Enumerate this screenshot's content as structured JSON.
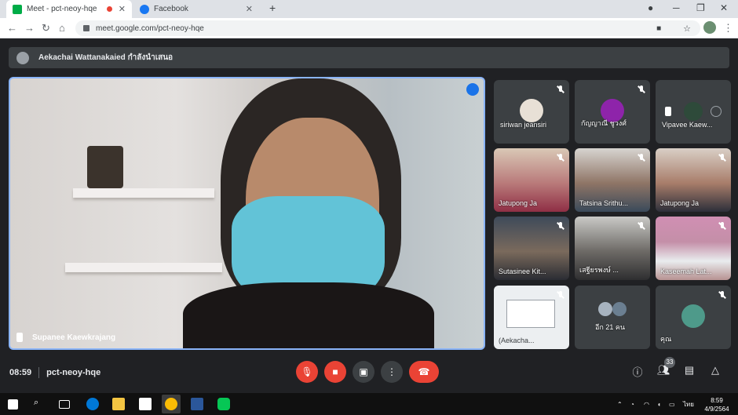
{
  "browser": {
    "tabs": [
      {
        "title": "Meet - pct-neoy-hqe",
        "active": true
      },
      {
        "title": "Facebook",
        "active": false
      }
    ],
    "address": "meet.google.com/pct-neoy-hqe"
  },
  "presenter_bar": {
    "text": "Aekachai Wattanakaied กำลังนำเสนอ"
  },
  "main_tile": {
    "name": "Supanee Kaewkrajang"
  },
  "tiles": [
    {
      "name": "siriwan jeansiri"
    },
    {
      "name": "กัญญาณี ชูวงศ์"
    },
    {
      "name": "Vipavee Kaew..."
    },
    {
      "name": "Jatupong Ja"
    },
    {
      "name": "Tatsina Srithu..."
    },
    {
      "name": "Jatupong Ja"
    },
    {
      "name": "Sutasinee Kit..."
    },
    {
      "name": "เสฐียรพงษ์ ..."
    },
    {
      "name": "Kaseemah Lat..."
    },
    {
      "name": "(Aekacha..."
    },
    {
      "name": "อีก 21 คน"
    },
    {
      "name": "คุณ"
    }
  ],
  "bottom_bar": {
    "time": "08:59",
    "meeting_code": "pct-neoy-hqe",
    "participant_count": "33"
  },
  "taskbar": {
    "clock_time": "8:59",
    "clock_date": "4/9/2564",
    "language": "ไทย"
  },
  "colors": {
    "accent": "#8ab4f8",
    "danger": "#ea4335",
    "surface": "#3c4043"
  }
}
